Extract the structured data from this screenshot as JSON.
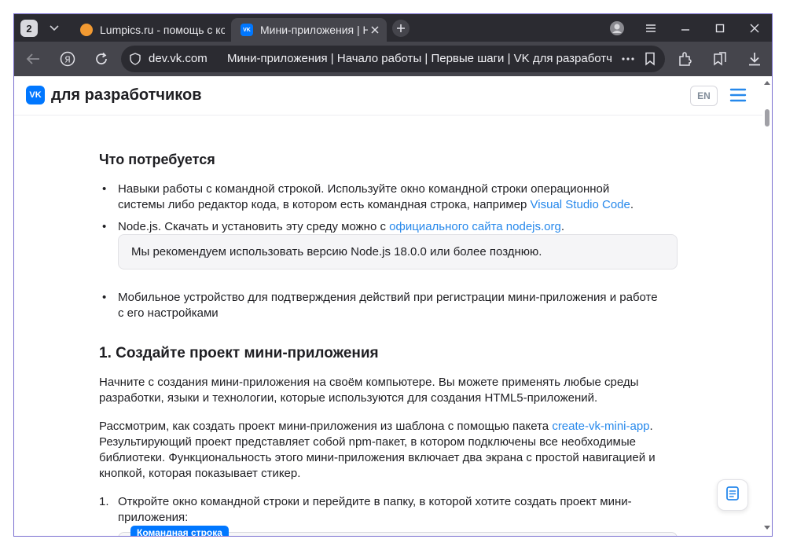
{
  "browser": {
    "tab_count": "2",
    "tabs": [
      {
        "title": "Lumpics.ru - помощь с компьютером",
        "favicon_color": "#f29a32"
      },
      {
        "title": "Мини-приложения | Начало работы",
        "favicon_color": "#0077ff",
        "active": true
      }
    ],
    "address": {
      "domain": "dev.vk.com",
      "page_title": "Мини-приложения | Начало работы | Первые шаги | VK для разработчиков"
    },
    "icons": [
      "tab-list-icon",
      "new-tab-icon",
      "profile-icon",
      "menu-icon",
      "minimize-icon",
      "maximize-icon",
      "close-icon",
      "back-icon",
      "yandex-icon",
      "reload-icon",
      "site-info-icon",
      "more-icon",
      "bookmark-icon",
      "extensions-icon",
      "collections-icon",
      "download-icon"
    ]
  },
  "site": {
    "logo_text": "VK",
    "name": "для разработчиков",
    "lang_button": "EN",
    "accent_color": "#0077ff",
    "link_color": "#2688eb"
  },
  "content": {
    "requirements_heading": "Что потребуется",
    "bullet1_text": "Навыки работы с командной строкой. Используйте окно командной строки операционной системы либо редактор кода, в котором есть командная строка, например ",
    "bullet1_link": "Visual Studio Code",
    "bullet1_end": ".",
    "bullet2_text": "Node.js. Скачать и установить эту среду можно с ",
    "bullet2_link": "официального сайта nodejs.org",
    "bullet2_end": ".",
    "note": "Мы рекомендуем использовать версию Node.js 18.0.0 или более позднюю.",
    "bullet3_text": "Мобильное устройство для подтверждения действий при регистрации мини-приложения и работе с его настройками",
    "section_heading": "1. Создайте проект мини-приложения",
    "para1": "Начните с создания мини-приложения на своём компьютере. Вы можете применять любые среды разработки, языки и технологии, которые используются для создания HTML5-приложений.",
    "para2_start": "Рассмотрим, как создать проект мини-приложения из шаблона с помощью пакета ",
    "para2_link": "create-vk-mini-app",
    "para2_end": ". Результирующий проект представляет собой npm-пакет, в котором подключены все необходимые библиотеки. Функциональность этого мини-приложения включает два экрана с простой навигацией и кнопкой, которая показывает стикер.",
    "step1_number": "1.",
    "step1_text": "Откройте окно командной строки и перейдите в папку, в которой хотите создать проект мини-приложения:",
    "code_label": "Командная строка"
  }
}
